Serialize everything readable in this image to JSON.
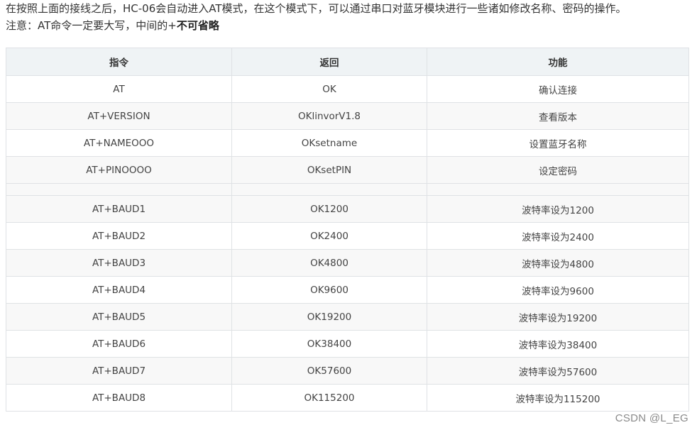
{
  "intro": {
    "line1": "在按照上面的接线之后，HC-06会自动进入AT模式，在这个模式下，可以通过串口对蓝牙模块进行一些诸如修改名称、密码的操作。",
    "line2_prefix": "注意：AT命令一定要大写，中间的+",
    "line2_strong": "不可省略"
  },
  "table": {
    "headers": [
      "指令",
      "返回",
      "功能"
    ],
    "rows": [
      [
        "AT",
        "OK",
        "确认连接"
      ],
      [
        "AT+VERSION",
        "OKlinvorV1.8",
        "查看版本"
      ],
      [
        "AT+NAMEOOO",
        "OKsetname",
        "设置蓝牙名称"
      ],
      [
        "AT+PINOOOO",
        "OKsetPIN",
        "设定密码"
      ],
      [
        "",
        "",
        ""
      ],
      [
        "AT+BAUD1",
        "OK1200",
        "波特率设为1200"
      ],
      [
        "AT+BAUD2",
        "OK2400",
        "波特率设为2400"
      ],
      [
        "AT+BAUD3",
        "OK4800",
        "波特率设为4800"
      ],
      [
        "AT+BAUD4",
        "OK9600",
        "波特率设为9600"
      ],
      [
        "AT+BAUD5",
        "OK19200",
        "波特率设为19200"
      ],
      [
        "AT+BAUD6",
        "OK38400",
        "波特率设为38400"
      ],
      [
        "AT+BAUD7",
        "OK57600",
        "波特率设为57600"
      ],
      [
        "AT+BAUD8",
        "OK115200",
        "波特率设为115200"
      ]
    ]
  },
  "watermark": "CSDN @L_EG"
}
